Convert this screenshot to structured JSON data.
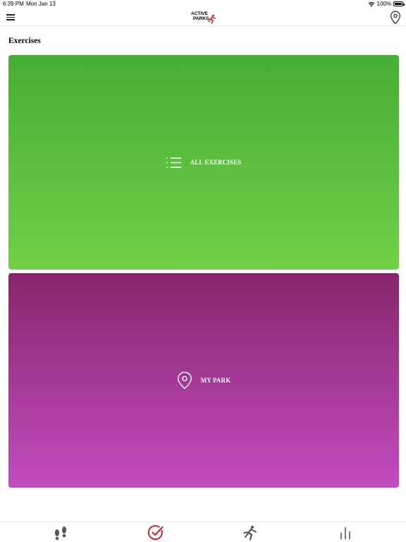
{
  "status_bar": {
    "time": "6:39 PM",
    "date": "Mon Jan 13",
    "battery": "100%"
  },
  "header": {
    "logo_line1": "ACTIVE",
    "logo_line2": "PARKS",
    "menu_icon": "hamburger-icon",
    "location_icon": "map-pin-icon"
  },
  "main": {
    "title": "Exercises",
    "cards": [
      {
        "label": "ALL EXERCISES",
        "icon": "list-icon",
        "color_top": "#46ad35",
        "color_bottom": "#72d048"
      },
      {
        "label": "MY PARK",
        "icon": "map-pin-icon",
        "color_top": "#86266c",
        "color_bottom": "#c24dbf"
      }
    ]
  },
  "tab_bar": {
    "tabs": [
      {
        "icon": "footprints-icon",
        "active": false
      },
      {
        "icon": "check-circle-icon",
        "active": true
      },
      {
        "icon": "runner-icon",
        "active": false
      },
      {
        "icon": "bar-chart-icon",
        "active": false
      }
    ],
    "active_color": "#c9262c",
    "inactive_color": "#555555"
  },
  "colors": {
    "logo_accent": "#d11f2a"
  }
}
